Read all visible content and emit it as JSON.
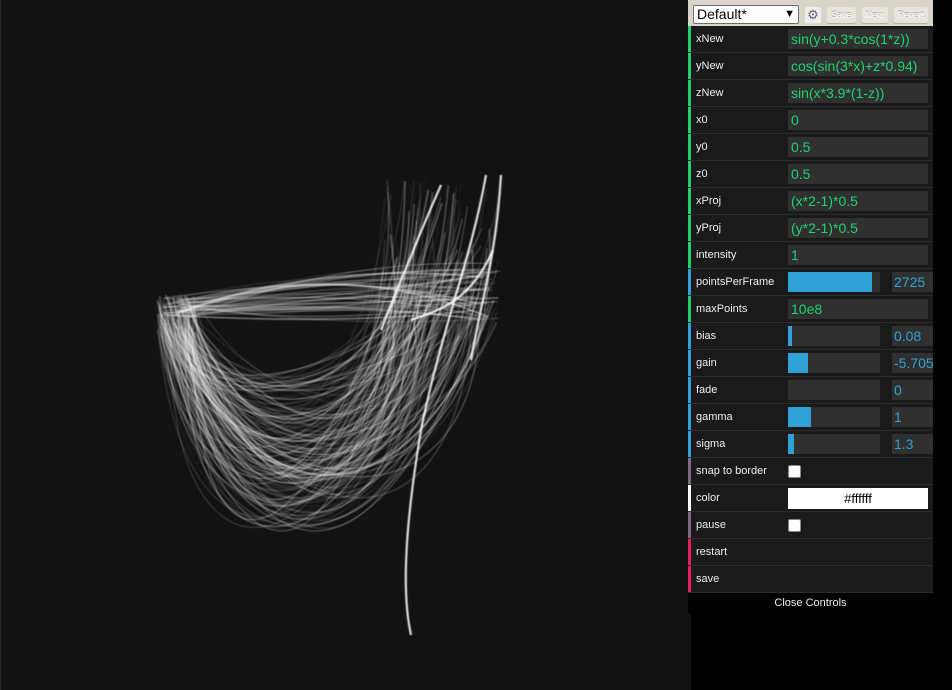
{
  "preset": {
    "selected": "Default*",
    "save_label": "Save",
    "new_label": "New",
    "revert_label": "Revert",
    "gear_icon": "gear-icon"
  },
  "controls": [
    {
      "label": "xNew",
      "type": "text",
      "value": "sin(y+0.3*cos(1*z))",
      "accent": "#1ed36f"
    },
    {
      "label": "yNew",
      "type": "text",
      "value": "cos(sin(3*x)+z*0.94)",
      "accent": "#1ed36f"
    },
    {
      "label": "zNew",
      "type": "text",
      "value": "sin(x*3.9*(1-z))",
      "accent": "#1ed36f"
    },
    {
      "label": "x0",
      "type": "text",
      "value": "0",
      "accent": "#1ed36f"
    },
    {
      "label": "y0",
      "type": "text",
      "value": "0.5",
      "accent": "#1ed36f"
    },
    {
      "label": "z0",
      "type": "text",
      "value": "0.5",
      "accent": "#1ed36f"
    },
    {
      "label": "xProj",
      "type": "text",
      "value": "(x*2-1)*0.5",
      "accent": "#1ed36f"
    },
    {
      "label": "yProj",
      "type": "text",
      "value": "(y*2-1)*0.5",
      "accent": "#1ed36f"
    },
    {
      "label": "intensity",
      "type": "text",
      "value": "1",
      "accent": "#1ed36f"
    },
    {
      "label": "pointsPerFrame",
      "type": "slider",
      "value": "2725",
      "fill": 0.91,
      "accent": "#2fa1d6"
    },
    {
      "label": "maxPoints",
      "type": "text",
      "value": "10e8",
      "accent": "#1ed36f"
    },
    {
      "label": "bias",
      "type": "slider",
      "value": "0.08",
      "fill": 0.04,
      "accent": "#2fa1d6"
    },
    {
      "label": "gain",
      "type": "slider",
      "value": "-5.705",
      "fill": 0.22,
      "accent": "#2fa1d6"
    },
    {
      "label": "fade",
      "type": "slider",
      "value": "0",
      "fill": 0.0,
      "accent": "#2fa1d6"
    },
    {
      "label": "gamma",
      "type": "slider",
      "value": "1",
      "fill": 0.25,
      "accent": "#2fa1d6"
    },
    {
      "label": "sigma",
      "type": "slider",
      "value": "1.3",
      "fill": 0.06,
      "accent": "#2fa1d6"
    },
    {
      "label": "snap to border",
      "type": "checkbox",
      "checked": false,
      "accent": "#806787"
    },
    {
      "label": "color",
      "type": "color",
      "value": "#ffffff",
      "accent": "#ffffff"
    },
    {
      "label": "pause",
      "type": "checkbox",
      "checked": false,
      "accent": "#806787"
    },
    {
      "label": "restart",
      "type": "function",
      "accent": "#e61d5f"
    },
    {
      "label": "save",
      "type": "function",
      "accent": "#e61d5f"
    }
  ],
  "close_label": "Close Controls"
}
